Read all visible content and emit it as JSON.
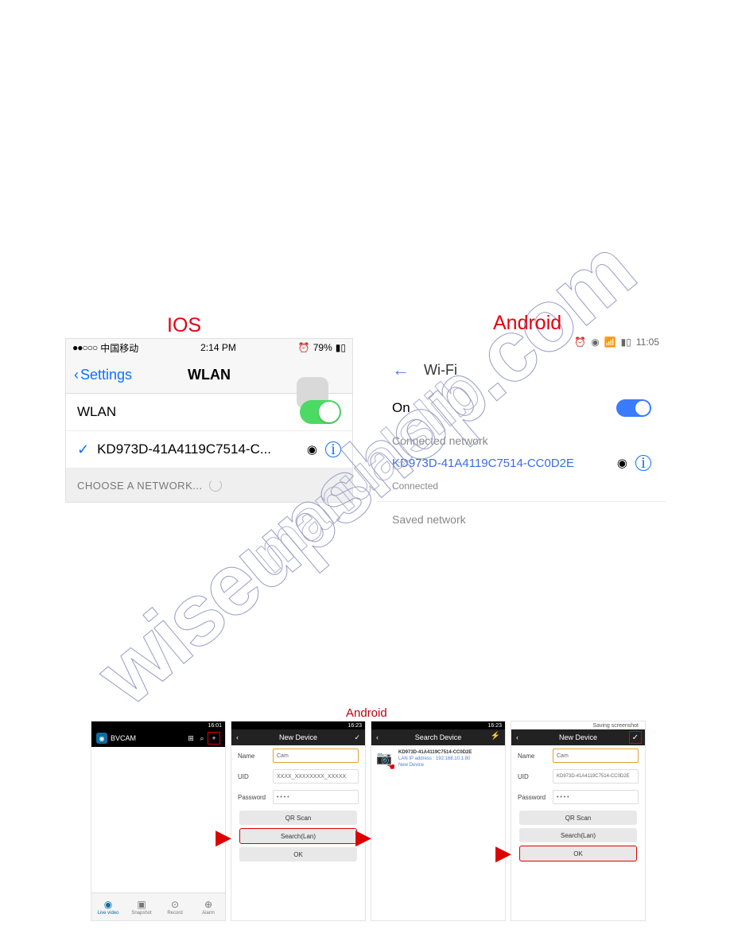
{
  "watermark_main": "wiseupshop.com",
  "watermark_sub": "manualslib",
  "top": {
    "ios_label": "IOS",
    "android_label": "Android",
    "ios": {
      "carrier": "中国移动",
      "time": "2:14 PM",
      "battery": "79%",
      "back": "Settings",
      "title": "WLAN",
      "wlan_label": "WLAN",
      "network": "KD973D-41A4119C7514-C...",
      "choose": "CHOOSE A NETWORK..."
    },
    "android": {
      "time": "11:05",
      "title": "Wi-Fi",
      "on": "On",
      "connected_hdr": "Connected network",
      "network": "KD973D-41A4119C7514-CC0D2E",
      "connected": "Connected",
      "saved_hdr": "Saved network"
    }
  },
  "bottom": {
    "label": "Android",
    "status_time": "16:01",
    "status_time2": "16:23",
    "bvcam": "BVCAM",
    "new_device": "New Device",
    "search_device": "Search Device",
    "saving": "Saving screenshot",
    "name_lbl": "Name",
    "uid_lbl": "UID",
    "pwd_lbl": "Password",
    "cam": "Cam",
    "uid_ph": "XXXX_XXXXXXXX_XXXXX",
    "pwd_val": "• • • •",
    "qr": "QR Scan",
    "search": "Search(Lan)",
    "ok": "OK",
    "dev_id": "KD973D-41A4119C7514-CC0D2E",
    "dev_ip": "LAN IP address : 192.168.10.1:80",
    "dev_new": "New Device",
    "uid_full": "KD973D-41A4119C7514-CC0D2E",
    "nav": {
      "live": "Live video",
      "snap": "Snapshot",
      "rec": "Record",
      "alarm": "Alarm"
    }
  }
}
